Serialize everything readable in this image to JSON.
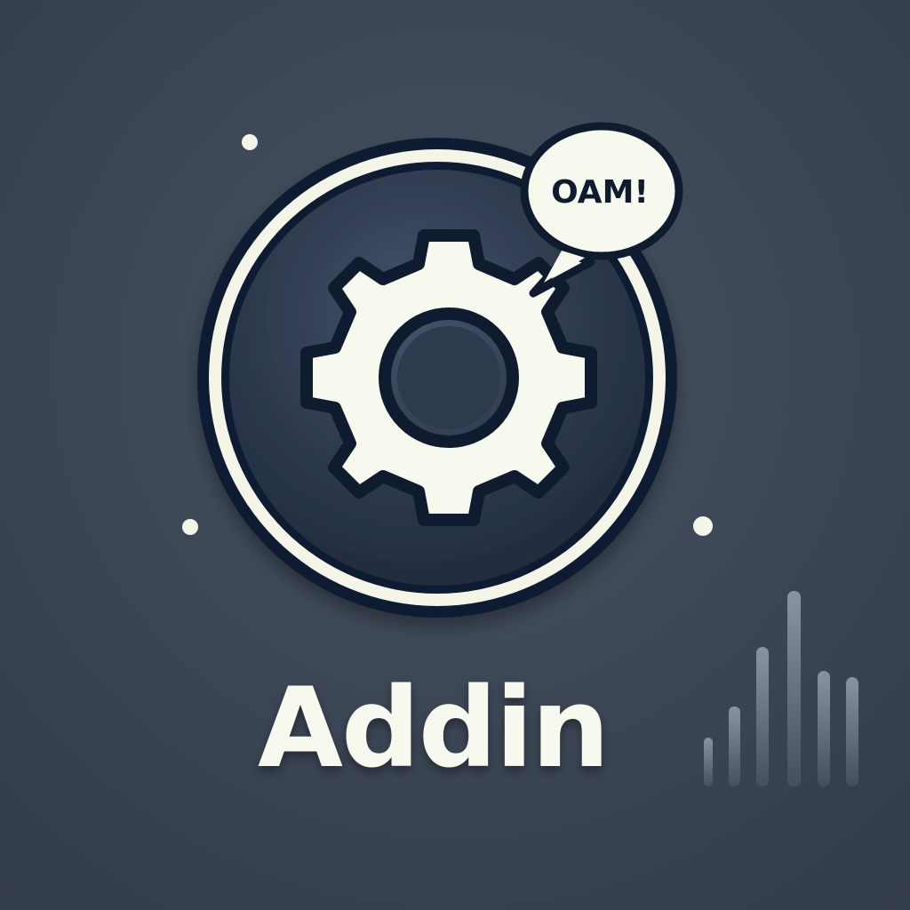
{
  "logo": {
    "wordmark": "Addin",
    "speech_bubble_text": "OAM!",
    "main_icon": "gear-icon",
    "secondary_icon": "signal-bars-icon"
  },
  "colors": {
    "background": "#3d4756",
    "badge_fill": "#2e3a4c",
    "badge_ring": "#f4f5e6",
    "outline": "#0f1c30",
    "gear": "#f8f9ee",
    "bars": "#8894a4",
    "text": "#f8f9ee"
  }
}
